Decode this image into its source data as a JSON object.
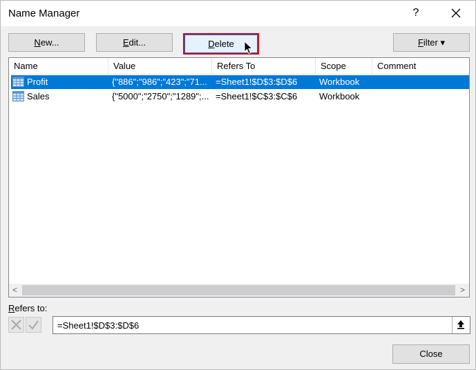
{
  "window": {
    "title": "Name Manager",
    "help": "?"
  },
  "toolbar": {
    "new_label_underlined": "N",
    "new_label_rest": "ew...",
    "edit_label_underlined": "E",
    "edit_label_rest": "dit...",
    "delete_label_underlined": "D",
    "delete_label_rest": "elete",
    "filter_label_underlined": "F",
    "filter_label_rest": "ilter",
    "filter_caret": "▾"
  },
  "table": {
    "columns": [
      "Name",
      "Value",
      "Refers To",
      "Scope",
      "Comment"
    ],
    "rows": [
      {
        "name": "Profit",
        "value": "{\"886\";\"986\";\"423\";\"71...",
        "refers_to": "=Sheet1!$D$3:$D$6",
        "scope": "Workbook",
        "comment": "",
        "selected": true
      },
      {
        "name": "Sales",
        "value": "{\"5000\";\"2750\";\"1289\";...",
        "refers_to": "=Sheet1!$C$3:$C$6",
        "scope": "Workbook",
        "comment": "",
        "selected": false
      }
    ]
  },
  "scrollbar": {
    "left_arrow": "<",
    "right_arrow": ">"
  },
  "refers": {
    "label_underlined": "R",
    "label_rest": "efers to:",
    "value": "=Sheet1!$D$3:$D$6"
  },
  "footer": {
    "close_label": "Close"
  },
  "icons": {
    "cancel": "x-icon",
    "confirm": "check-icon",
    "collapse": "upload-arrow-icon",
    "cursor": "mouse-pointer-icon",
    "range": "grid-icon"
  },
  "colors": {
    "selection": "#0078d7",
    "highlight_outline": "#e0001b"
  }
}
